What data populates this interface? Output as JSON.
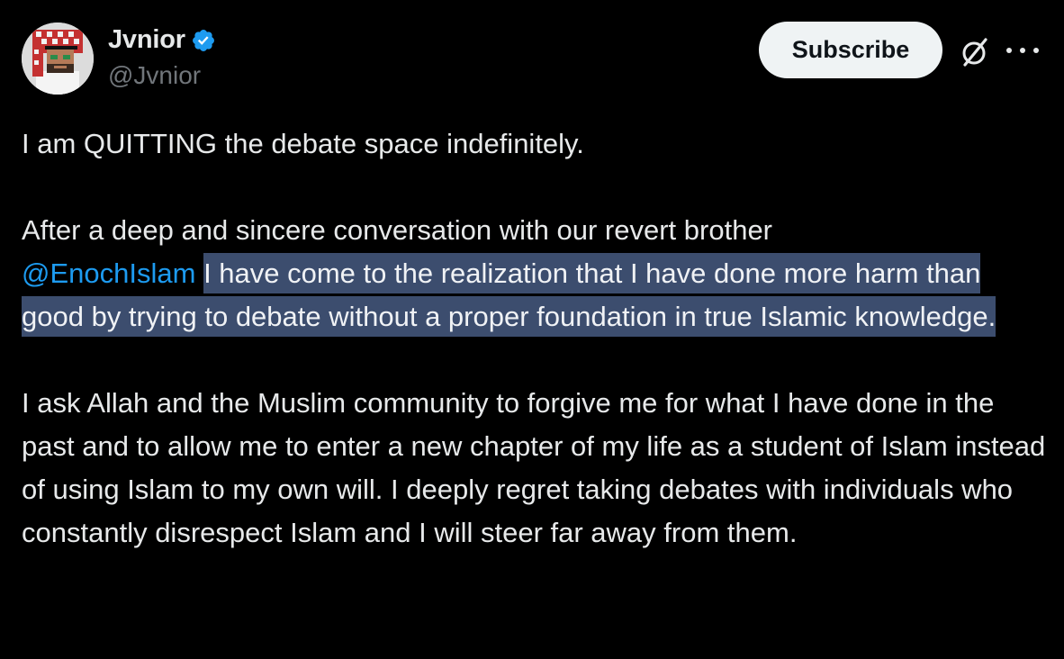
{
  "author": {
    "display_name": "Jvnior",
    "handle": "@Jvnior",
    "verified": true,
    "verified_color": "#1d9bf0"
  },
  "actions": {
    "subscribe_label": "Subscribe",
    "grok_icon": "grok-icon",
    "more_icon": "more-horizontal-icon"
  },
  "tweet": {
    "p1": "I am QUITTING the debate space indefinitely.",
    "p2_lead": "After a deep and sincere conversation with our revert brother",
    "p2_mention": "@EnochIslam",
    "p2_highlighted": "I have come to the realization that I have done more harm than good by trying to debate without a proper foundation in true Islamic knowledge.",
    "p3": "I ask Allah and the Muslim community to forgive me for what I have done in the past and to allow me to enter a new chapter of my life as a student of Islam instead of using Islam to my own will. I deeply regret taking debates with individuals who constantly disrespect Islam and I will steer far away from them."
  },
  "colors": {
    "background": "#000000",
    "text": "#e7e9ea",
    "secondary_text": "#71767b",
    "mention": "#1d9bf0",
    "selection_highlight": "#3c4d6e"
  }
}
